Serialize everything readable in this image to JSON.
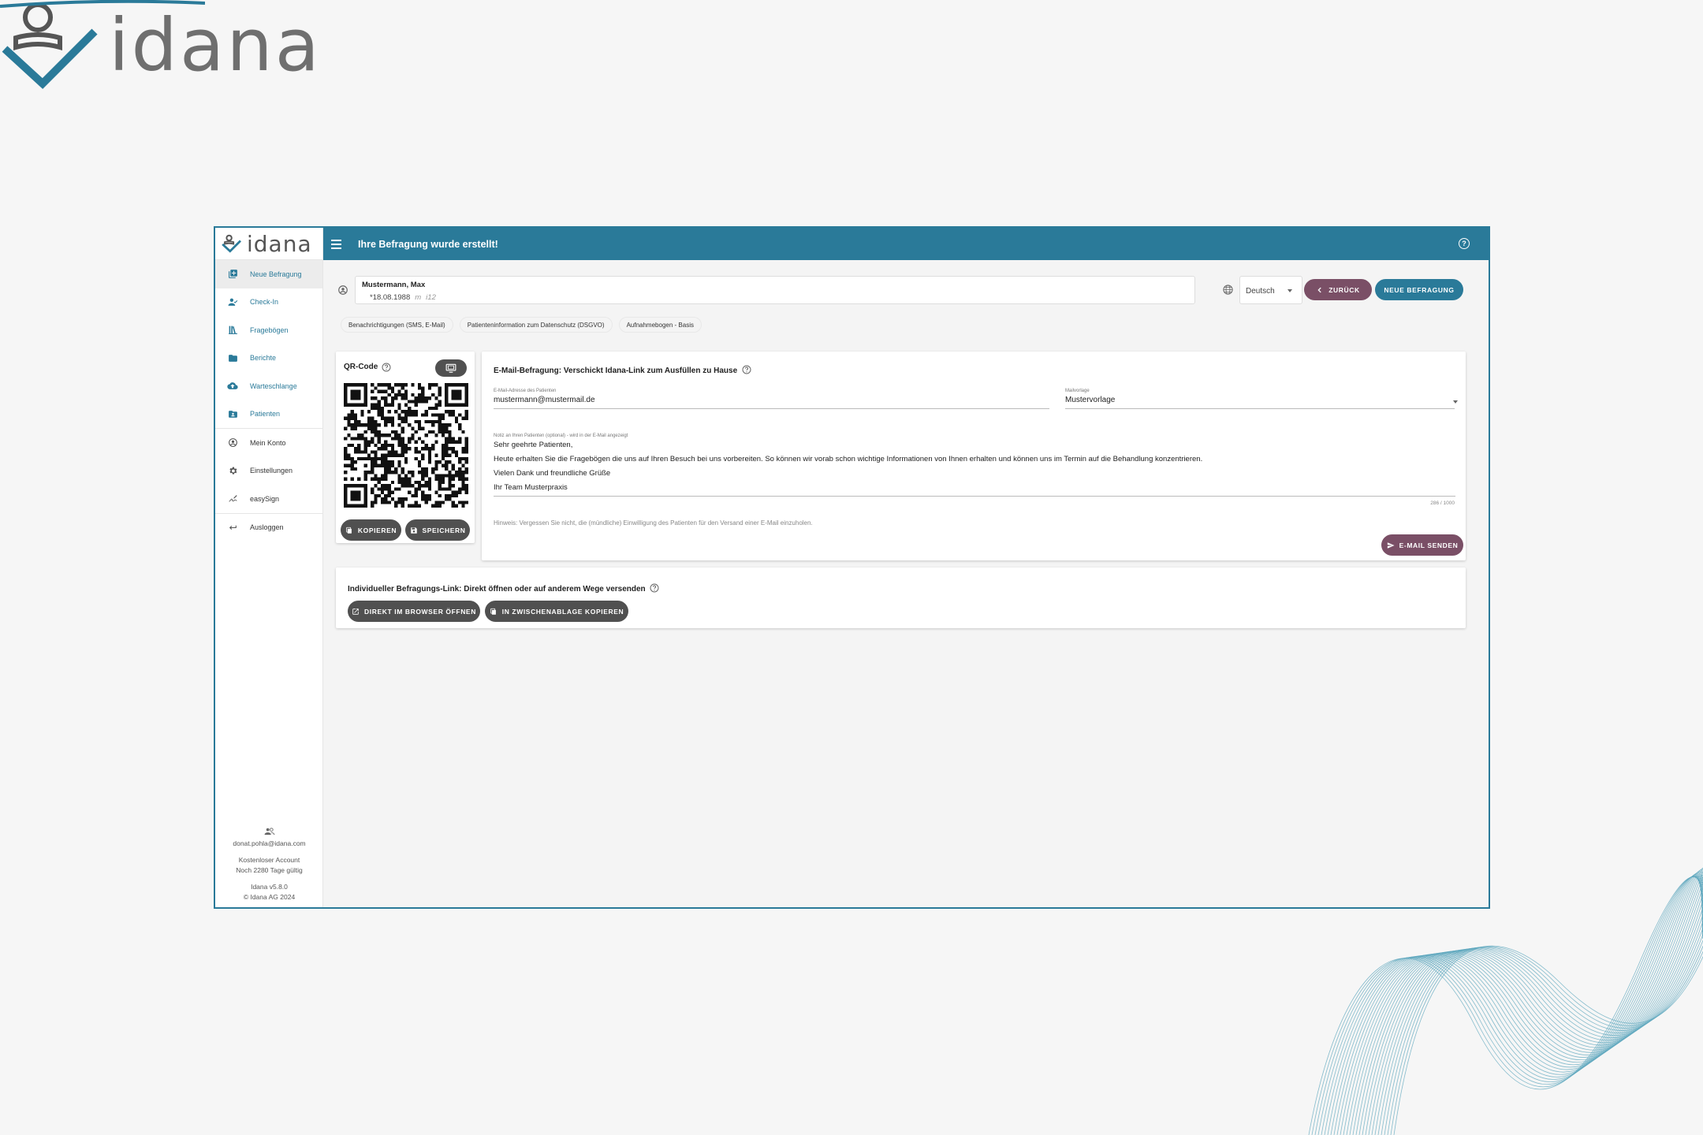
{
  "brand": {
    "name": "idana"
  },
  "window": {
    "title": "Ihre Befragung wurde erstellt!"
  },
  "sidebar": {
    "logo": "idana",
    "items": [
      {
        "label": "Neue Befragung",
        "icon": "add-box-icon",
        "active": true
      },
      {
        "label": "Check-In",
        "icon": "person-check-icon"
      },
      {
        "label": "Fragebögen",
        "icon": "library-books-icon"
      },
      {
        "label": "Berichte",
        "icon": "folder-icon"
      },
      {
        "label": "Warteschlange",
        "icon": "cloud-upload-icon"
      },
      {
        "label": "Patienten",
        "icon": "folder-account-icon"
      },
      {
        "label": "Mein Konto",
        "icon": "account-circle-icon"
      },
      {
        "label": "Einstellungen",
        "icon": "gear-icon"
      },
      {
        "label": "easySign",
        "icon": "signature-icon"
      },
      {
        "label": "Ausloggen",
        "icon": "logout-icon"
      }
    ],
    "footer": {
      "email": "donat.pohla@idana.com",
      "account_type": "Kostenloser Account",
      "validity": "Noch 2280 Tage gültig",
      "version": "Idana v5.8.0",
      "copyright": "© Idana AG 2024"
    }
  },
  "patient": {
    "name": "Mustermann, Max",
    "dob": "*18.08.1988",
    "gender_symbol": "m",
    "id": "i12"
  },
  "language": {
    "selected": "Deutsch"
  },
  "actions": {
    "back": "ZURÜCK",
    "new": "NEUE BEFRAGUNG"
  },
  "chips": [
    "Benachrichtigungen (SMS, E-Mail)",
    "Patienteninformation zum Datenschutz (DSGVO)",
    "Aufnahmebogen - Basis"
  ],
  "qr": {
    "title": "QR-Code",
    "copy": "KOPIEREN",
    "save": "SPEICHERN"
  },
  "mail": {
    "title": "E-Mail-Befragung: Verschickt Idana-Link zum Ausfüllen zu Hause",
    "email_label": "E-Mail-Adresse des Patienten",
    "email_value": "mustermann@mustermail.de",
    "template_label": "Mailvorlage",
    "template_value": "Mustervorlage",
    "note_label": "Notiz an Ihren Patienten (optional) - wird in der E-Mail angezeigt",
    "note_lines": [
      "Sehr geehrte Patienten,",
      "Heute erhalten Sie die Fragebögen die uns auf Ihren Besuch bei uns vorbereiten. So können wir vorab schon wichtige Informationen von Ihnen erhalten und können uns im Termin auf die Behandlung konzentrieren.",
      "Vielen Dank und freundliche Grüße",
      "Ihr Team Musterpraxis"
    ],
    "counter": "286 / 1000",
    "hint": "Hinweis: Vergessen Sie nicht, die (mündliche) Einwilligung des Patienten für den Versand einer E-Mail einzuholen.",
    "send": "E-MAIL SENDEN"
  },
  "link": {
    "title": "Individueller Befragungs-Link: Direkt öffnen oder auf anderem Wege versenden",
    "open": "DIREKT IM BROWSER ÖFFNEN",
    "copy": "IN ZWISCHENABLAGE KOPIEREN"
  },
  "colors": {
    "primary": "#2a7a99",
    "accent": "#7a4f66",
    "dark": "#505050"
  }
}
